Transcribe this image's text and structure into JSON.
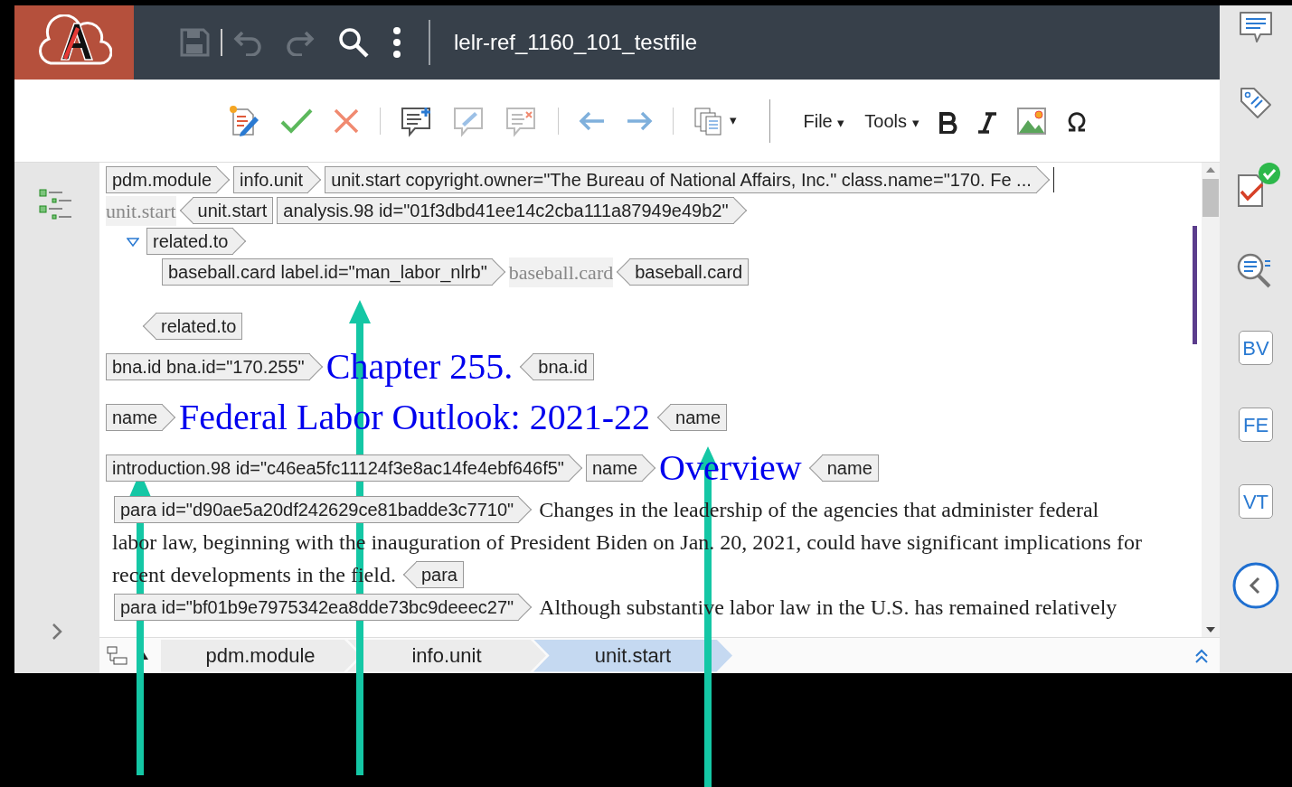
{
  "header": {
    "document_title": "lelr-ref_1160_101_testfile"
  },
  "toolbar": {
    "copy_caret": "▾",
    "menus": [
      {
        "label": "File",
        "caret": "▾"
      },
      {
        "label": "Tools",
        "caret": "▾"
      }
    ]
  },
  "editor": {
    "lines": [
      {
        "items": [
          {
            "kind": "open",
            "text": "pdm.module"
          },
          {
            "kind": "open",
            "text": "info.unit"
          },
          {
            "kind": "open",
            "text": "unit.start copyright.owner=\"The Bureau of National Affairs, Inc.\" class.name=\"170. Fe ..."
          }
        ],
        "cursor": true
      },
      {
        "items": [
          {
            "kind": "label",
            "text": "unit.start"
          },
          {
            "kind": "close",
            "text": "unit.start"
          },
          {
            "kind": "open",
            "text": "analysis.98 id=\"01f3dbd41ee14c2cba111a87949e49b2\""
          }
        ]
      },
      {
        "expanded": true,
        "items": [
          {
            "kind": "open",
            "text": "related.to"
          }
        ],
        "children": [
          {
            "items": [
              {
                "kind": "open",
                "text": "baseball.card label.id=\"man_labor_nlrb\""
              },
              {
                "kind": "label",
                "text": "baseball.card"
              },
              {
                "kind": "close",
                "text": "baseball.card"
              }
            ]
          }
        ],
        "closing": [
          {
            "kind": "close",
            "text": "related.to"
          }
        ]
      },
      {
        "items": [
          {
            "kind": "open",
            "text": "bna.id bna.id=\"170.255\""
          },
          {
            "kind": "heading",
            "text": "Chapter 255."
          },
          {
            "kind": "close",
            "text": "bna.id"
          }
        ]
      },
      {
        "items": [
          {
            "kind": "open",
            "text": "name"
          },
          {
            "kind": "heading",
            "text": "Federal Labor Outlook: 2021-22"
          },
          {
            "kind": "close",
            "text": "name"
          }
        ]
      },
      {
        "items": [
          {
            "kind": "open",
            "text": "introduction.98 id=\"c46ea5fc11124f3e8ac14fe4ebf646f5\""
          },
          {
            "kind": "open",
            "text": "name"
          },
          {
            "kind": "heading",
            "text": "Overview"
          },
          {
            "kind": "close",
            "text": "name"
          }
        ]
      },
      {
        "items": [
          {
            "kind": "open",
            "text": "para id=\"d90ae5a20df242629ce81badde3c7710\""
          },
          {
            "kind": "text",
            "text": "Changes in the leadership of the agencies that administer federal"
          }
        ]
      },
      {
        "items": [
          {
            "kind": "text",
            "text": "labor law, beginning with the inauguration of President Biden on Jan. 20, 2021, could have significant implications for"
          }
        ]
      },
      {
        "items": [
          {
            "kind": "text",
            "text": "recent developments in the field."
          },
          {
            "kind": "close",
            "text": "para"
          }
        ]
      },
      {
        "items": [
          {
            "kind": "open",
            "text": "para id=\"bf01b9e7975342ea8dde73bc9deeec27\""
          },
          {
            "kind": "text",
            "text": "Although substantive labor law in the U.S. has remained relatively"
          }
        ]
      }
    ]
  },
  "breadcrumbs": [
    {
      "label": "pdm.module",
      "selected": false
    },
    {
      "label": "info.unit",
      "selected": false
    },
    {
      "label": "unit.start",
      "selected": true
    }
  ],
  "side_panel": {
    "buttons": [
      "BV",
      "FE",
      "VT"
    ]
  }
}
